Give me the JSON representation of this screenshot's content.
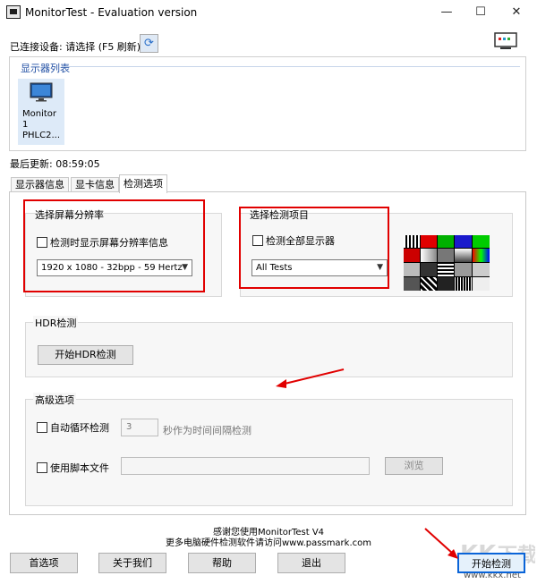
{
  "window": {
    "title": "MonitorTest - Evaluation version",
    "minimize": "—",
    "maximize": "☐",
    "close": "✕"
  },
  "header": {
    "connected_label": "已连接设备: 请选择 (F5 刷新)",
    "refresh_icon": "refresh-icon"
  },
  "monitor_list": {
    "header": "显示器列表",
    "items": [
      {
        "name": "Monitor 1",
        "model": "PHLC2..."
      }
    ]
  },
  "last_update": "最后更新: 08:59:05",
  "tabs": [
    {
      "label": "显示器信息",
      "active": false
    },
    {
      "label": "显卡信息",
      "active": false
    },
    {
      "label": "检测选项",
      "active": true
    }
  ],
  "resolution_group": {
    "title": "选择屏幕分辨率",
    "checkbox_label": "检测时显示屏幕分辨率信息",
    "select_value": "1920 x 1080 - 32bpp - 59 Hertz"
  },
  "test_group": {
    "title": "选择检测项目",
    "checkbox_label": "检测全部显示器",
    "select_value": "All Tests"
  },
  "hdr_group": {
    "title": "HDR检测",
    "button_label": "开始HDR检测"
  },
  "advanced_group": {
    "title": "高级选项",
    "auto_loop_label": "自动循环检测",
    "interval_value": "3",
    "interval_suffix": "秒作为时间间隔检测",
    "script_label": "使用脚本文件",
    "script_value": "",
    "browse_label": "浏览"
  },
  "footer": {
    "thanks": "感谢您使用MonitorTest V4",
    "more": "更多电脑硬件检测软件请访问www.passmark.com"
  },
  "buttons": {
    "preferences": "首选项",
    "about": "关于我们",
    "help": "帮助",
    "exit": "退出",
    "start": "开始检测"
  },
  "watermark": {
    "brand": "KK下载",
    "url": "www.kkx.net"
  },
  "colors": {
    "annotation_red": "#e10000",
    "header_blue": "#1f4ea3",
    "primary_blue": "#0a64d8"
  }
}
